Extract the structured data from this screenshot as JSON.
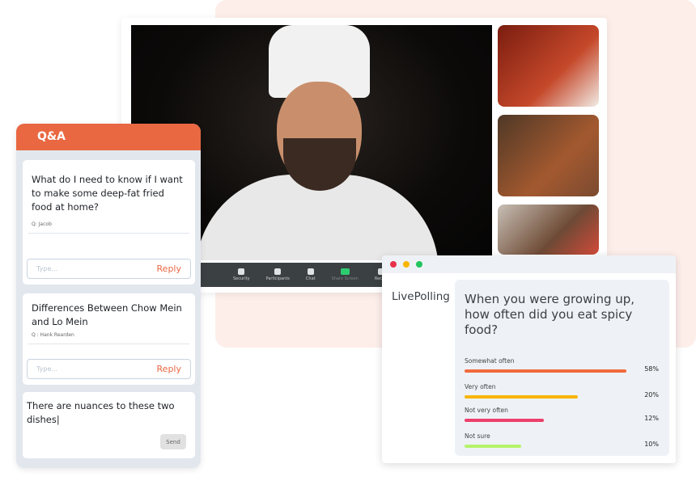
{
  "video": {
    "toolbar": [
      {
        "label": "Security",
        "icon": "shield-icon"
      },
      {
        "label": "Participants",
        "icon": "participants-icon"
      },
      {
        "label": "Chat",
        "icon": "chat-icon"
      },
      {
        "label": "Share Screen",
        "icon": "share-screen-icon"
      },
      {
        "label": "Record",
        "icon": "record-icon"
      }
    ]
  },
  "qa": {
    "title": "Q&A",
    "questions": [
      {
        "text": "What do I need to know if I want to make some deep-fat fried food at home?",
        "author": "Q: Jacob",
        "placeholder": "Type...",
        "reply": "Reply"
      },
      {
        "text": "Differences Between Chow Mein and Lo Mein",
        "author": "Q : Hank Rearden",
        "placeholder": "Type...",
        "reply": "Reply"
      }
    ],
    "compose": {
      "value": "There are nuances to these two dishes|",
      "send": "Send"
    }
  },
  "poll": {
    "brand": "LivePolling",
    "question": "When you were growing up, how often did you eat spicy food?",
    "options": [
      {
        "label": "Somewhat often",
        "percent": "58%",
        "fill": 1.0,
        "color": "#f26a3d"
      },
      {
        "label": "Very often",
        "percent": "20%",
        "fill": 0.7,
        "color": "#f9b500"
      },
      {
        "label": "Not very often",
        "percent": "12%",
        "fill": 0.49,
        "color": "#ee3f6c"
      },
      {
        "label": "Not sure",
        "percent": "10%",
        "fill": 0.35,
        "color": "#b5f36b"
      }
    ],
    "window_dots": [
      "#e8334a",
      "#f9b500",
      "#22c55e"
    ]
  }
}
